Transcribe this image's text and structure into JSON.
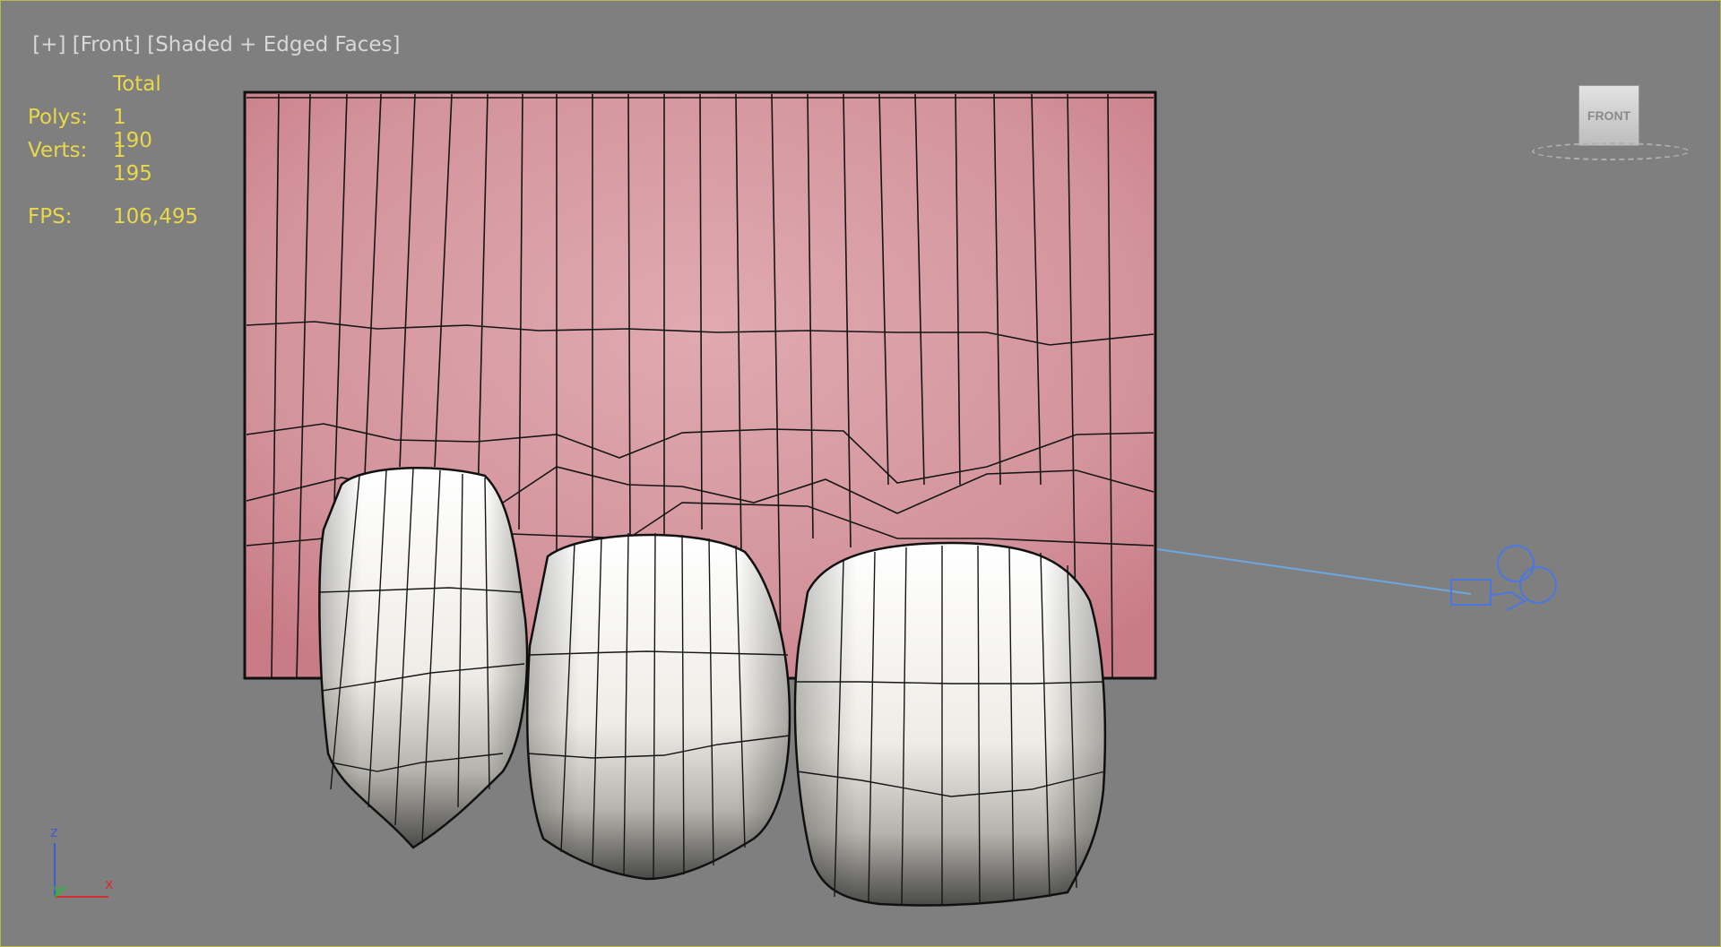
{
  "viewport": {
    "label_plus": "[+]",
    "label_view": "[Front]",
    "label_shading": "[Shaded + Edged Faces]"
  },
  "stats": {
    "header": "Total",
    "polys_label": "Polys:",
    "polys_value": "1 190",
    "verts_label": "Verts:",
    "verts_value": "1 195",
    "fps_label": "FPS:",
    "fps_value": "106,495"
  },
  "viewcube": {
    "face_label": "FRONT"
  },
  "axis": {
    "z_label": "z",
    "y_label": "y",
    "x_label": "x"
  },
  "colors": {
    "viewport_bg": "#7f7f7f",
    "stats_text": "#e8d84a",
    "gum": "#d08a92",
    "tooth": "#f2f0ea",
    "camera": "#4a78e0"
  }
}
